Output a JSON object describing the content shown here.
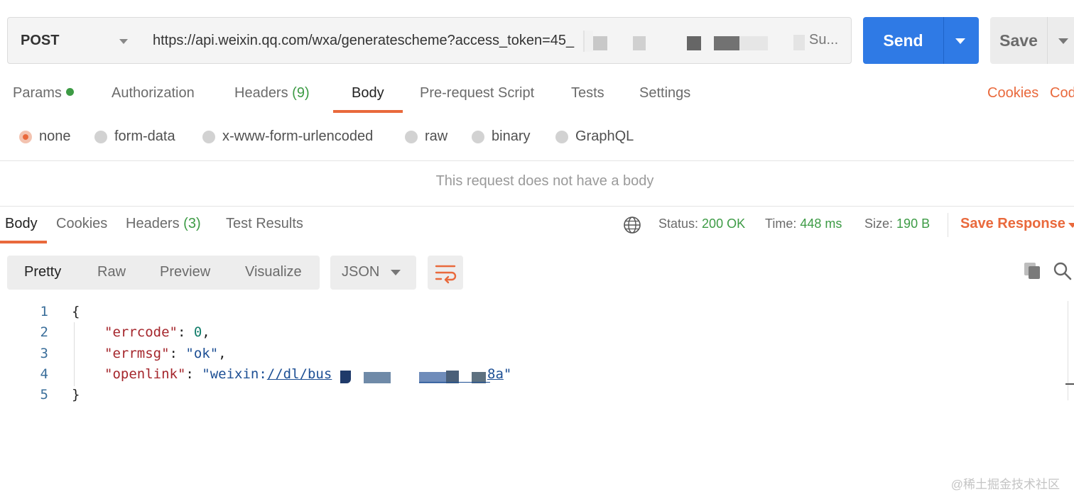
{
  "request": {
    "method": "POST",
    "url_visible": "https://api.weixin.qq.com/wxa/generatescheme?access_token=45_",
    "url_tail": "Su...",
    "send_label": "Send",
    "save_label": "Save"
  },
  "request_tabs": [
    {
      "label": "Params"
    },
    {
      "label": "Authorization"
    },
    {
      "label": "Headers",
      "count": "(9)"
    },
    {
      "label": "Body"
    },
    {
      "label": "Pre-request Script"
    },
    {
      "label": "Tests"
    },
    {
      "label": "Settings"
    }
  ],
  "request_links": {
    "cookies": "Cookies",
    "code": "Cod"
  },
  "body_types": [
    "none",
    "form-data",
    "x-www-form-urlencoded",
    "raw",
    "binary",
    "GraphQL"
  ],
  "body_selected": "none",
  "empty_body_message": "This request does not have a body",
  "response_tabs": [
    {
      "label": "Body"
    },
    {
      "label": "Cookies"
    },
    {
      "label": "Headers",
      "count": "(3)"
    },
    {
      "label": "Test Results"
    }
  ],
  "status": {
    "status_label": "Status:",
    "status_value": "200 OK",
    "time_label": "Time:",
    "time_value": "448 ms",
    "size_label": "Size:",
    "size_value": "190 B",
    "save_response": "Save Response"
  },
  "viewer": {
    "modes": [
      "Pretty",
      "Raw",
      "Preview",
      "Visualize"
    ],
    "active_mode": "Pretty",
    "language": "JSON"
  },
  "code_lines": {
    "numbers": [
      "1",
      "2",
      "3",
      "4",
      "5"
    ],
    "open_brace": "{",
    "close_brace": "}",
    "k1": "\"errcode\"",
    "v1": "0",
    "k2": "\"errmsg\"",
    "v2": "\"ok\"",
    "k3": "\"openlink\"",
    "v3_prefix": "\"weixin:",
    "v3_link": "//dl/bus",
    "v3_suffix": "8a",
    "v3_close": "\""
  },
  "watermark": "@稀土掘金技术社区",
  "colors": {
    "accent_orange": "#e9693c",
    "send_blue": "#2f7ae5",
    "status_green": "#3d9b45"
  },
  "icons": [
    "chevron-down-icon",
    "globe-icon",
    "copy-icon",
    "search-icon",
    "wrap-lines-icon"
  ]
}
